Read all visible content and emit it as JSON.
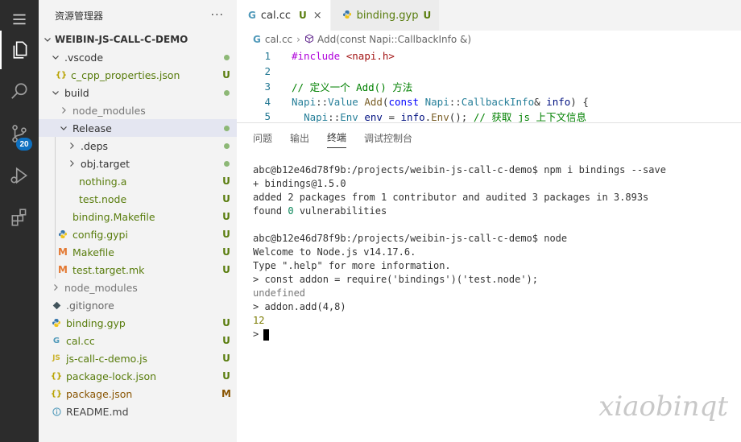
{
  "activity_bar": {
    "items": [
      {
        "icon": "explorer-icon"
      },
      {
        "icon": "search-icon"
      },
      {
        "icon": "source-control-icon",
        "badge": "20"
      },
      {
        "icon": "run-debug-icon"
      },
      {
        "icon": "extensions-icon"
      }
    ]
  },
  "sidebar": {
    "title": "资源管理器",
    "more": "···",
    "root": "WEIBIN-JS-CALL-C-DEMO",
    "items": [
      {
        "label": ".vscode",
        "status": "dot"
      },
      {
        "label": "c_cpp_properties.json",
        "icon": "{}",
        "status": "U"
      },
      {
        "label": "build",
        "status": "dot"
      },
      {
        "label": "node_modules",
        "status": ""
      },
      {
        "label": "Release",
        "status": "dot"
      },
      {
        "label": ".deps",
        "status": "dot"
      },
      {
        "label": "obj.target",
        "status": "dot"
      },
      {
        "label": "nothing.a",
        "status": "U"
      },
      {
        "label": "test.node",
        "status": "U"
      },
      {
        "label": "binding.Makefile",
        "status": "U"
      },
      {
        "label": "config.gypi",
        "status": "U"
      },
      {
        "label": "Makefile",
        "icon": "M",
        "status": "U"
      },
      {
        "label": "test.target.mk",
        "icon": "M",
        "status": "U"
      },
      {
        "label": "node_modules",
        "status": ""
      },
      {
        "label": ".gitignore",
        "status": ""
      },
      {
        "label": "binding.gyp",
        "status": "U"
      },
      {
        "label": "cal.cc",
        "icon": "G",
        "status": "U"
      },
      {
        "label": "js-call-c-demo.js",
        "icon": "JS",
        "status": "U"
      },
      {
        "label": "package-lock.json",
        "icon": "{}",
        "status": "U"
      },
      {
        "label": "package.json",
        "icon": "{}",
        "status": "M"
      },
      {
        "label": "README.md",
        "status": ""
      }
    ]
  },
  "tabs": [
    {
      "label": "cal.cc",
      "status": "U",
      "close": "×"
    },
    {
      "label": "binding.gyp",
      "status": "U"
    }
  ],
  "breadcrumb": {
    "file": "cal.cc",
    "symbol": "Add(const Napi::CallbackInfo &)"
  },
  "code_lines": [
    {
      "n": "1",
      "text": "#include <napi.h>"
    },
    {
      "n": "2",
      "text": ""
    },
    {
      "n": "3",
      "text": "// 定义一个 Add() 方法"
    },
    {
      "n": "4",
      "text": "Napi::Value Add(const Napi::CallbackInfo& info) {"
    },
    {
      "n": "5",
      "text": "  Napi::Env env = info.Env(); // 获取 js 上下文信息"
    }
  ],
  "panel_tabs": [
    "问题",
    "输出",
    "终端",
    "调试控制台"
  ],
  "terminal_lines": [
    "abc@b12e46d78f9b:/projects/weibin-js-call-c-demo$ npm i bindings --save",
    "+ bindings@1.5.0",
    "added 2 packages from 1 contributor and audited 3 packages in 3.893s",
    "found 0 vulnerabilities",
    "",
    "abc@b12e46d78f9b:/projects/weibin-js-call-c-demo$ node",
    "Welcome to Node.js v14.17.6.",
    "Type \".help\" for more information.",
    "> const addon = require('bindings')('test.node');",
    "undefined",
    "> addon.add(4,8)",
    "12",
    ">"
  ],
  "watermark": "xiaobinqt",
  "colors": {
    "activity_bg": "#2c2c2c",
    "sidebar_bg": "#f3f3f3",
    "untracked": "#587c0c",
    "modified": "#895503",
    "badge": "#0e70c0"
  }
}
